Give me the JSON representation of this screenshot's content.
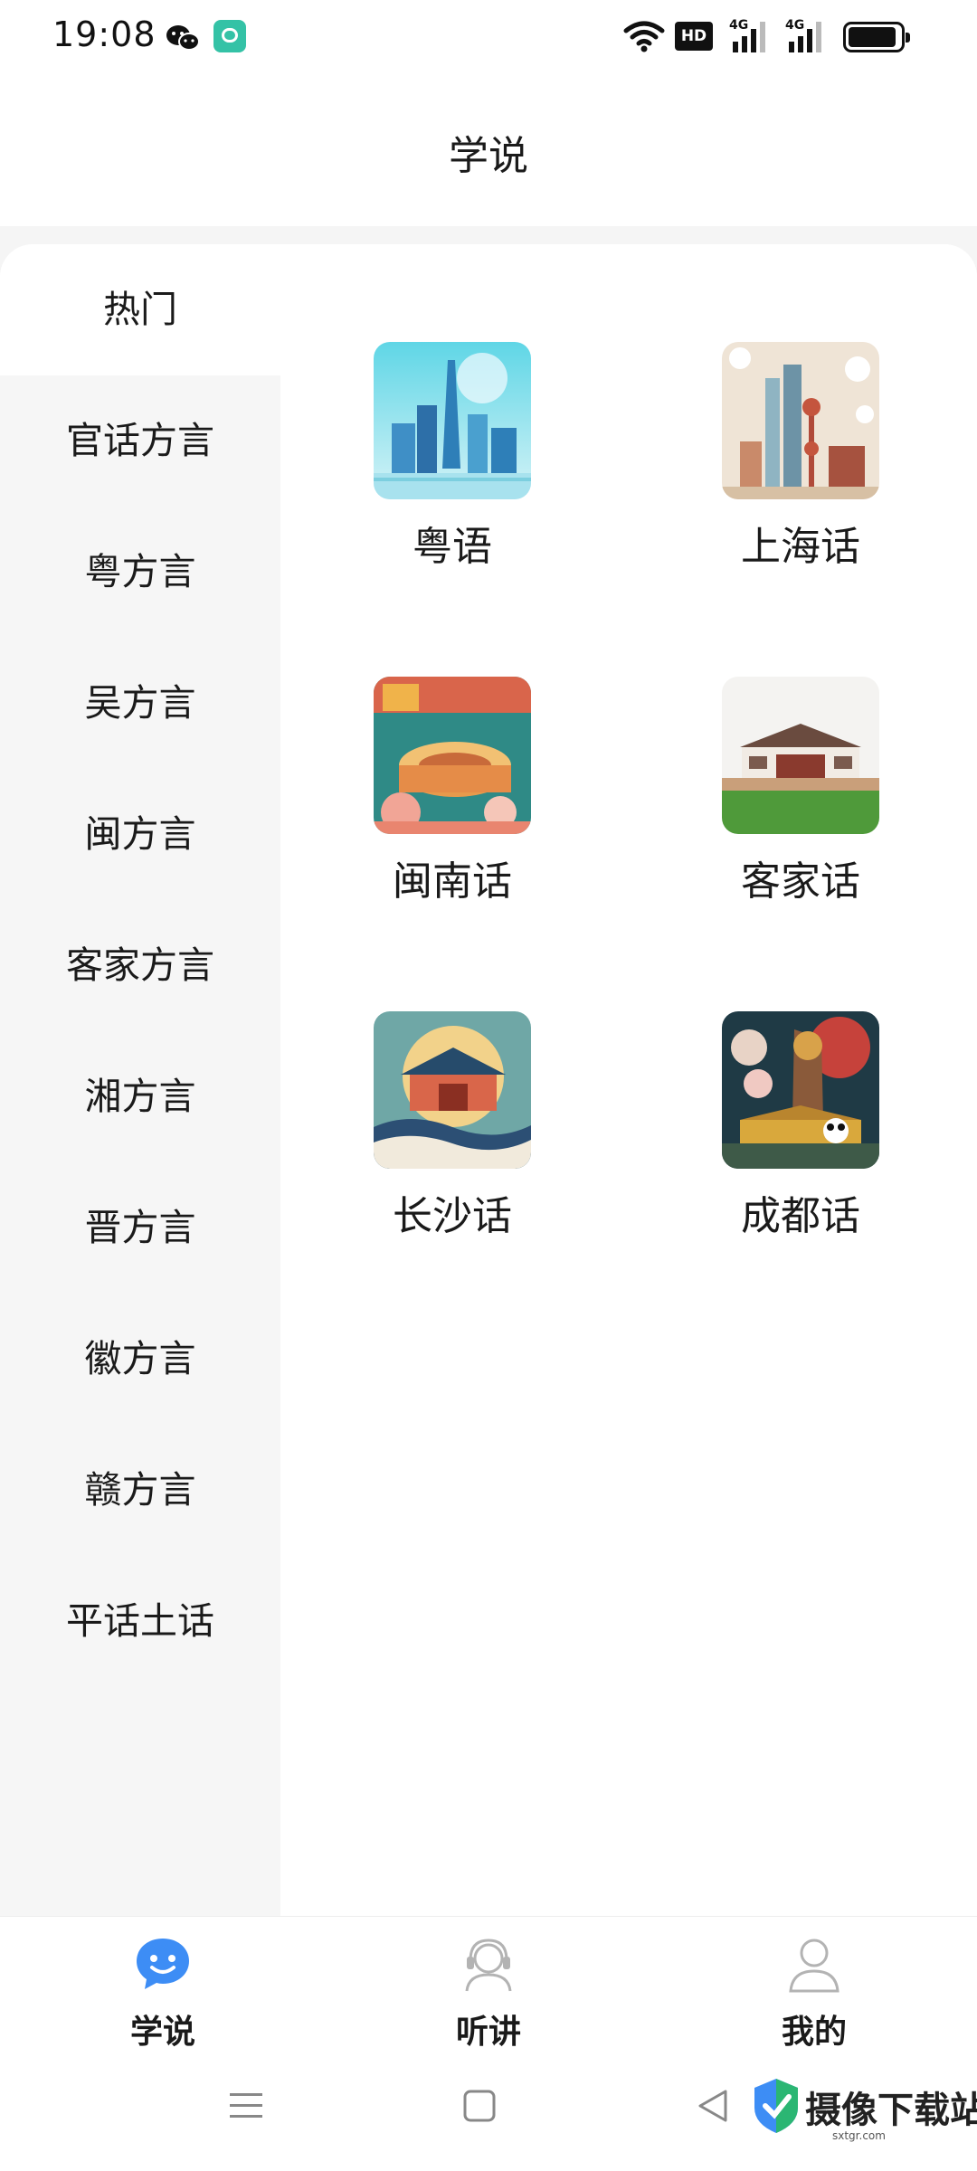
{
  "status_bar": {
    "time": "19:08",
    "icons": [
      "wechat-icon",
      "app-notification-icon",
      "wifi-icon",
      "hd-icon",
      "signal-4g-icon",
      "signal-4g-icon",
      "battery-icon"
    ],
    "hd_label": "HD",
    "network_1": "4G",
    "network_2": "4G"
  },
  "header": {
    "title": "学说"
  },
  "sidebar": {
    "items": [
      {
        "label": "热门",
        "active": true
      },
      {
        "label": "官话方言",
        "active": false
      },
      {
        "label": "粤方言",
        "active": false
      },
      {
        "label": "吴方言",
        "active": false
      },
      {
        "label": "闽方言",
        "active": false
      },
      {
        "label": "客家方言",
        "active": false
      },
      {
        "label": "湘方言",
        "active": false
      },
      {
        "label": "晋方言",
        "active": false
      },
      {
        "label": "徽方言",
        "active": false
      },
      {
        "label": "赣方言",
        "active": false
      },
      {
        "label": "平话土话",
        "active": false
      }
    ]
  },
  "dialects": [
    {
      "label": "粤语",
      "icon": "guangzhou-tower-illustration"
    },
    {
      "label": "上海话",
      "icon": "shanghai-skyline-illustration"
    },
    {
      "label": "闽南话",
      "icon": "tulou-illustration"
    },
    {
      "label": "客家话",
      "icon": "hakka-house-illustration"
    },
    {
      "label": "长沙话",
      "icon": "changsha-pavilion-illustration"
    },
    {
      "label": "成都话",
      "icon": "sichuan-opera-panda-illustration"
    }
  ],
  "bottom_nav": {
    "items": [
      {
        "label": "学说",
        "icon": "chat-smile-icon",
        "active": true
      },
      {
        "label": "听讲",
        "icon": "headset-icon",
        "active": false
      },
      {
        "label": "我的",
        "icon": "person-icon",
        "active": false
      }
    ]
  },
  "colors": {
    "accent": "#3d8df5",
    "sidebar_bg": "#f6f6f6",
    "inactive_icon": "#b3b3b3"
  },
  "watermark": {
    "text": "摄像下载站",
    "url": "sxtgr.com"
  }
}
